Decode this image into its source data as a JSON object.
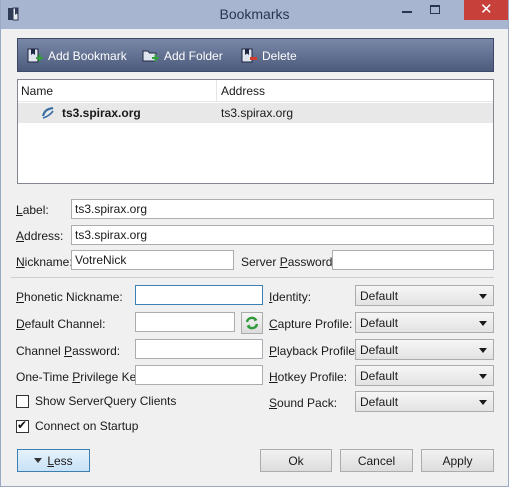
{
  "window": {
    "title": "Bookmarks",
    "close_glyph": "✕",
    "icons": {
      "app": "bookmark-book-icon",
      "minimize": "minimize-icon",
      "maximize": "maximize-icon",
      "close": "close-icon"
    }
  },
  "toolbar": {
    "add_bookmark": "Add Bookmark",
    "add_folder": "Add Folder",
    "delete": "Delete"
  },
  "tree": {
    "columns": [
      "Name",
      "Address"
    ],
    "rows": [
      {
        "name": "ts3.spirax.org",
        "address": "ts3.spirax.org",
        "selected": true,
        "icon": "teamspeak-server-icon"
      }
    ]
  },
  "form": {
    "label": {
      "caption": "Label:",
      "value": "ts3.spirax.org"
    },
    "address": {
      "caption": "Address:",
      "value": "ts3.spirax.org"
    },
    "nickname": {
      "caption": "Nickname:",
      "value": "VotreNick"
    },
    "server_password": {
      "caption": "Server Password:",
      "value": ""
    },
    "phonetic_nickname": {
      "caption": "Phonetic Nickname:",
      "value": ""
    },
    "default_channel": {
      "caption": "Default Channel:",
      "value": ""
    },
    "channel_password": {
      "caption": "Channel Password:",
      "value": ""
    },
    "one_time_key": {
      "caption": "One-Time Privilege Key:",
      "value": ""
    },
    "identity": {
      "caption": "Identity:",
      "selected": "Default"
    },
    "capture_profile": {
      "caption": "Capture Profile:",
      "selected": "Default"
    },
    "playback_profile": {
      "caption": "Playback Profile:",
      "selected": "Default"
    },
    "hotkey_profile": {
      "caption": "Hotkey Profile:",
      "selected": "Default"
    },
    "sound_pack": {
      "caption": "Sound Pack:",
      "selected": "Default"
    },
    "show_serverquery": {
      "caption": "Show ServerQuery Clients",
      "checked": false
    },
    "connect_on_startup": {
      "caption": "Connect on Startup",
      "checked": true
    }
  },
  "buttons": {
    "less": "Less",
    "ok": "Ok",
    "cancel": "Cancel",
    "apply": "Apply"
  },
  "colors": {
    "titlebar": "#a7b5d1",
    "toolbar": "#4c5a7c",
    "close": "#c7413a",
    "selection": "#e8e8e8",
    "focus": "#3c7fb1"
  }
}
